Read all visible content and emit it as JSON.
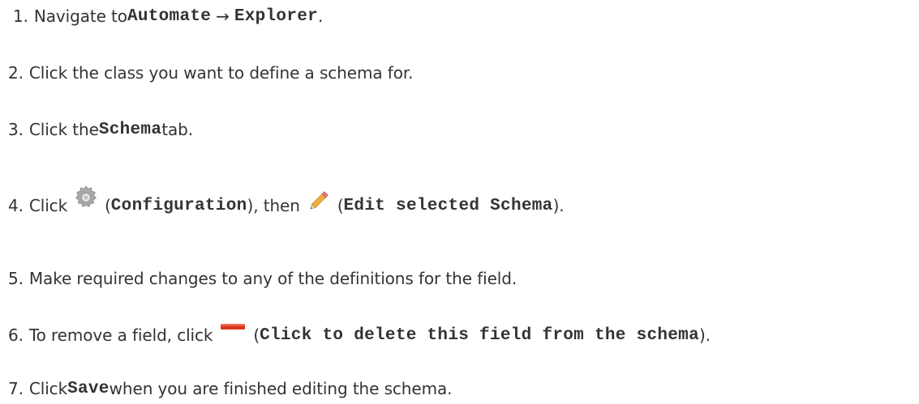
{
  "steps": [
    {
      "number": "1.",
      "parts": {
        "text_a": "Navigate to ",
        "code_a": "Automate",
        "arrow": "→",
        "code_b": "Explorer",
        "text_b": "."
      }
    },
    {
      "number": "2.",
      "parts": {
        "text_a": "Click the class you want to define a schema for."
      }
    },
    {
      "number": "3.",
      "parts": {
        "text_a": "Click the ",
        "code_a": "Schema",
        "text_b": " tab."
      }
    },
    {
      "number": "4.",
      "parts": {
        "text_a": "Click",
        "icon_a": "gear-icon",
        "text_b": "(",
        "code_a": "Configuration",
        "text_c": "), then",
        "icon_b": "pencil-icon",
        "text_d": "(",
        "code_b": "Edit selected Schema",
        "text_e": ")."
      }
    },
    {
      "number": "5.",
      "parts": {
        "text_a": "Make required changes to any of the definitions for the field."
      }
    },
    {
      "number": "6.",
      "parts": {
        "text_a": "To remove a field, click",
        "icon_a": "minus-icon",
        "text_b": "(",
        "code_a": "Click to delete this field from the schema",
        "text_c": ")."
      }
    },
    {
      "number": "7.",
      "parts": {
        "text_a": "Click ",
        "code_a": "Save",
        "text_b": " when you are finished editing the schema."
      }
    }
  ],
  "colors": {
    "text": "#333333",
    "minus_icon": "#d9381e",
    "gear_icon": "#a0a0a0",
    "pencil_icon": "#e8a640"
  }
}
